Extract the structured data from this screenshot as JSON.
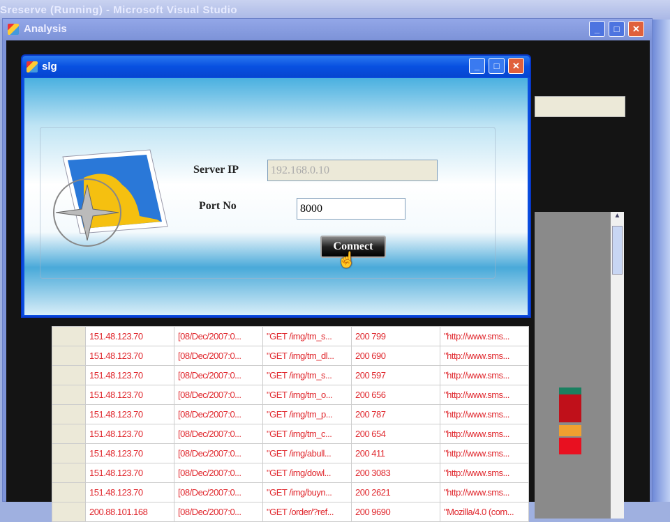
{
  "background_window": {
    "title": "Sreserve (Running) - Microsoft Visual Studio"
  },
  "analysis_window": {
    "title": "Analysis",
    "buttons": {
      "minimize": "_",
      "maximize": "□",
      "close": "✕"
    }
  },
  "dialog": {
    "title": "slg",
    "buttons": {
      "minimize": "_",
      "maximize": "□",
      "close": "✕"
    },
    "server_ip_label": "Server IP",
    "server_ip_value": "192.168.0.10",
    "port_label": "Port No",
    "port_value": "8000",
    "connect_label": "Connect",
    "cursor": "☝"
  },
  "log_table": {
    "rows": [
      [
        "151.48.123.70",
        "[08/Dec/2007:0...",
        "\"GET /img/tm_s...",
        "200 799",
        "\"http://www.sms..."
      ],
      [
        "151.48.123.70",
        "[08/Dec/2007:0...",
        "\"GET /img/tm_dl...",
        "200 690",
        "\"http://www.sms..."
      ],
      [
        "151.48.123.70",
        "[08/Dec/2007:0...",
        "\"GET /img/tm_s...",
        "200 597",
        "\"http://www.sms..."
      ],
      [
        "151.48.123.70",
        "[08/Dec/2007:0...",
        "\"GET /img/tm_o...",
        "200 656",
        "\"http://www.sms..."
      ],
      [
        "151.48.123.70",
        "[08/Dec/2007:0...",
        "\"GET /img/tm_p...",
        "200 787",
        "\"http://www.sms..."
      ],
      [
        "151.48.123.70",
        "[08/Dec/2007:0...",
        "\"GET /img/tm_c...",
        "200 654",
        "\"http://www.sms..."
      ],
      [
        "151.48.123.70",
        "[08/Dec/2007:0...",
        "\"GET /img/abull...",
        "200 411",
        "\"http://www.sms..."
      ],
      [
        "151.48.123.70",
        "[08/Dec/2007:0...",
        "\"GET /img/dowl...",
        "200 3083",
        "\"http://www.sms..."
      ],
      [
        "151.48.123.70",
        "[08/Dec/2007:0...",
        "\"GET /img/buyn...",
        "200 2621",
        "\"http://www.sms..."
      ],
      [
        "200.88.101.168",
        "[08/Dec/2007:0...",
        "\"GET /order/?ref...",
        "200 9690",
        "\"Mozilla/4.0 (com..."
      ]
    ]
  },
  "colors": {
    "log_text": "#e0282e",
    "titlebar": "#0a4ee0"
  }
}
